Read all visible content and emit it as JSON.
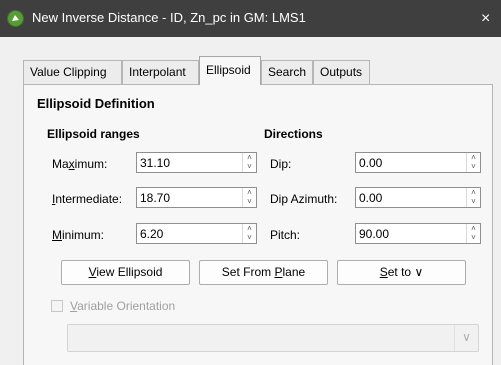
{
  "window": {
    "title": "New Inverse Distance - ID, Zn_pc in GM: LMS1",
    "close_glyph": "×",
    "app_icon": "leapfrog-app-icon"
  },
  "tabs": [
    {
      "label": "Value Clipping"
    },
    {
      "label": "Interpolant"
    },
    {
      "label": "Ellipsoid",
      "selected": true
    },
    {
      "label": "Search"
    },
    {
      "label": "Outputs"
    }
  ],
  "section": {
    "title": "Ellipsoid Definition"
  },
  "ranges": {
    "heading": "Ellipsoid ranges",
    "maximum": {
      "label_pre": "Ma",
      "label_u": "x",
      "label_post": "imum:",
      "value": "31.10"
    },
    "intermediate": {
      "label_pre": "",
      "label_u": "I",
      "label_post": "ntermediate:",
      "value": "18.70"
    },
    "minimum": {
      "label_pre": "",
      "label_u": "M",
      "label_post": "inimum:",
      "value": "6.20"
    }
  },
  "directions": {
    "heading": "Directions",
    "dip": {
      "label": "Dip:",
      "value": "0.00"
    },
    "dip_azimuth": {
      "label": "Dip Azimuth:",
      "value": "0.00"
    },
    "pitch": {
      "label": "Pitch:",
      "value": "90.00"
    }
  },
  "buttons": {
    "view_ellipsoid": {
      "u": "V",
      "rest": "iew Ellipsoid"
    },
    "set_from_plane": {
      "pre": "Set From ",
      "u": "P",
      "rest": "lane"
    },
    "set_to": {
      "u": "S",
      "rest": "et to",
      "chevron": "∨"
    }
  },
  "variable_orientation": {
    "u": "V",
    "rest": "ariable Orientation",
    "checked": false,
    "enabled": false
  },
  "combo": {
    "value": "",
    "chevron": "∨"
  },
  "spin_arrows": {
    "up": "˄",
    "down": "˅"
  },
  "colors": {
    "titlebar": "#3f3f3f",
    "panel": "#f7f7f7",
    "disabled_text": "#a0a0a0"
  }
}
